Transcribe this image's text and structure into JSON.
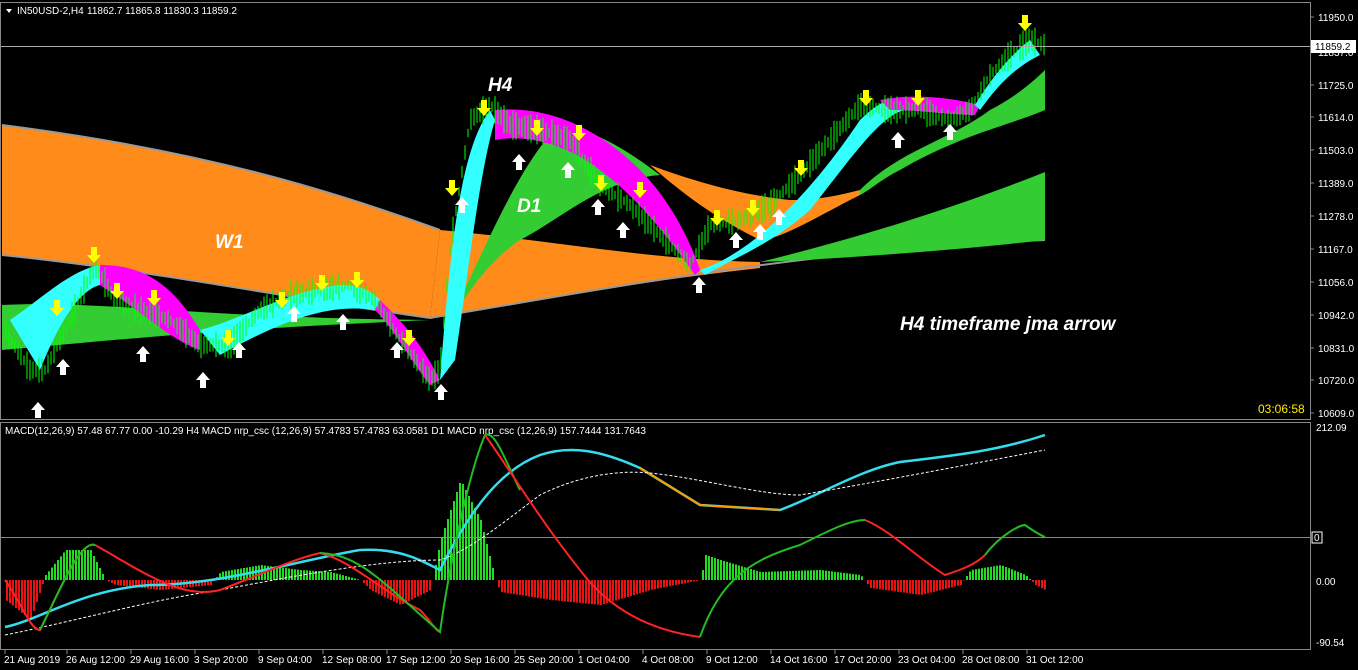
{
  "header": {
    "symbol_label": "IN50USD-2,H4",
    "ohlc": "11862.7 11865.8 11830.3 11859.2"
  },
  "labels": {
    "w1": "W1",
    "d1": "D1",
    "h4": "H4",
    "annotation": "H4 timeframe jma arrow"
  },
  "timer": "03:06:58",
  "price_tag": "11859.2",
  "indicator_header": "MACD(12,26,9) 57.48 67.77 0.00 -10.29  H4 MACD nrp_csc (12,26,9) 57.4783 57.4783 63.0581  D1 MACD nrp_csc (12,26,9) 157.7444 131.7643",
  "price_axis": [
    "11950.0",
    "11837.0",
    "11725.0",
    "11614.0",
    "11503.0",
    "11389.0",
    "11278.0",
    "11167.0",
    "11056.0",
    "10942.0",
    "10831.0",
    "10720.0",
    "10609.0"
  ],
  "macd_axis": {
    "top": "212.09",
    "zero_marker": "0",
    "mid": "0.00",
    "bottom": "-90.54"
  },
  "time_axis": [
    "21 Aug 2019",
    "26 Aug 12:00",
    "29 Aug 16:00",
    "3 Sep 20:00",
    "9 Sep 04:00",
    "12 Sep 08:00",
    "17 Sep 12:00",
    "20 Sep 16:00",
    "25 Sep 20:00",
    "1 Oct 04:00",
    "4 Oct 08:00",
    "9 Oct 12:00",
    "14 Oct 16:00",
    "17 Oct 20:00",
    "23 Oct 04:00",
    "28 Oct 08:00",
    "31 Oct 12:00"
  ],
  "colors": {
    "bull_candle": "#00ff00",
    "w1_band": "#ff8c1a",
    "d1_band": "#33cc33",
    "h4_up": "#33ffff",
    "h4_down": "#ff00ff",
    "sell_arrow": "#ffff00",
    "buy_arrow": "#ffffff",
    "macd_line": "#33ddee",
    "macd_hist_pos": "#22dd22",
    "macd_hist_neg": "#ee1111",
    "timer": "#ffee00"
  },
  "chart_data": [
    {
      "type": "line",
      "title": "IN50USD-2,H4",
      "y_range": [
        10609,
        11950
      ],
      "last_price": 11859.2,
      "series": []
    },
    {
      "type": "bar",
      "title": "MACD(12,26,9)",
      "y_range": [
        -90.54,
        212.09
      ],
      "series": []
    }
  ]
}
